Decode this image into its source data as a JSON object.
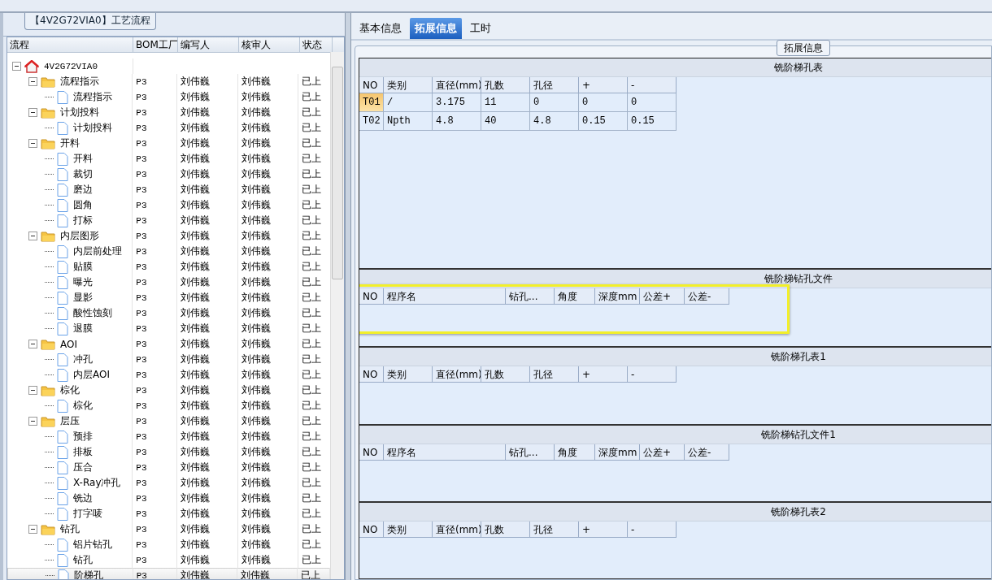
{
  "left_panel": {
    "title": "【4V2G72VIA0】工艺流程",
    "columns": [
      "流程",
      "BOM工厂",
      "编写人",
      "核审人",
      "状态"
    ],
    "tree": [
      {
        "name": "4V2G72VIA0",
        "kind": "root",
        "expanded": true,
        "selected": false,
        "children": [
          {
            "name": "流程指示",
            "kind": "folder",
            "expanded": true,
            "selected": false,
            "cells": [
              "P3",
              "刘伟巍",
              "刘伟巍",
              "已上"
            ],
            "children": [
              {
                "name": "流程指示",
                "kind": "step",
                "selected": false,
                "cells": [
                  "P3",
                  "刘伟巍",
                  "刘伟巍",
                  "已上"
                ]
              }
            ]
          },
          {
            "name": "计划投料",
            "kind": "folder",
            "expanded": true,
            "selected": false,
            "cells": [
              "P3",
              "刘伟巍",
              "刘伟巍",
              "已上"
            ],
            "children": [
              {
                "name": "计划投料",
                "kind": "step",
                "selected": false,
                "cells": [
                  "P3",
                  "刘伟巍",
                  "刘伟巍",
                  "已上"
                ]
              }
            ]
          },
          {
            "name": "开料",
            "kind": "folder",
            "expanded": true,
            "selected": false,
            "cells": [
              "P3",
              "刘伟巍",
              "刘伟巍",
              "已上"
            ],
            "children": [
              {
                "name": "开料",
                "kind": "step",
                "selected": false,
                "cells": [
                  "P3",
                  "刘伟巍",
                  "刘伟巍",
                  "已上"
                ]
              },
              {
                "name": "裁切",
                "kind": "step",
                "selected": false,
                "cells": [
                  "P3",
                  "刘伟巍",
                  "刘伟巍",
                  "已上"
                ]
              },
              {
                "name": "磨边",
                "kind": "step",
                "selected": false,
                "cells": [
                  "P3",
                  "刘伟巍",
                  "刘伟巍",
                  "已上"
                ]
              },
              {
                "name": "圆角",
                "kind": "step",
                "selected": false,
                "cells": [
                  "P3",
                  "刘伟巍",
                  "刘伟巍",
                  "已上"
                ]
              },
              {
                "name": "打标",
                "kind": "step",
                "selected": false,
                "cells": [
                  "P3",
                  "刘伟巍",
                  "刘伟巍",
                  "已上"
                ]
              }
            ]
          },
          {
            "name": "内层图形",
            "kind": "folder",
            "expanded": true,
            "selected": false,
            "cells": [
              "P3",
              "刘伟巍",
              "刘伟巍",
              "已上"
            ],
            "children": [
              {
                "name": "内层前处理",
                "kind": "step",
                "selected": false,
                "cells": [
                  "P3",
                  "刘伟巍",
                  "刘伟巍",
                  "已上"
                ]
              },
              {
                "name": "贴膜",
                "kind": "step",
                "selected": false,
                "cells": [
                  "P3",
                  "刘伟巍",
                  "刘伟巍",
                  "已上"
                ]
              },
              {
                "name": "曝光",
                "kind": "step",
                "selected": false,
                "cells": [
                  "P3",
                  "刘伟巍",
                  "刘伟巍",
                  "已上"
                ]
              },
              {
                "name": "显影",
                "kind": "step",
                "selected": false,
                "cells": [
                  "P3",
                  "刘伟巍",
                  "刘伟巍",
                  "已上"
                ]
              },
              {
                "name": "酸性蚀刻",
                "kind": "step",
                "selected": false,
                "cells": [
                  "P3",
                  "刘伟巍",
                  "刘伟巍",
                  "已上"
                ]
              },
              {
                "name": "退膜",
                "kind": "step",
                "selected": false,
                "cells": [
                  "P3",
                  "刘伟巍",
                  "刘伟巍",
                  "已上"
                ]
              }
            ]
          },
          {
            "name": "AOI",
            "kind": "folder",
            "expanded": true,
            "selected": false,
            "cells": [
              "P3",
              "刘伟巍",
              "刘伟巍",
              "已上"
            ],
            "children": [
              {
                "name": "冲孔",
                "kind": "step",
                "selected": false,
                "cells": [
                  "P3",
                  "刘伟巍",
                  "刘伟巍",
                  "已上"
                ]
              },
              {
                "name": "内层AOI",
                "kind": "step",
                "selected": false,
                "cells": [
                  "P3",
                  "刘伟巍",
                  "刘伟巍",
                  "已上"
                ]
              }
            ]
          },
          {
            "name": "棕化",
            "kind": "folder",
            "expanded": true,
            "selected": false,
            "cells": [
              "P3",
              "刘伟巍",
              "刘伟巍",
              "已上"
            ],
            "children": [
              {
                "name": "棕化",
                "kind": "step",
                "selected": false,
                "cells": [
                  "P3",
                  "刘伟巍",
                  "刘伟巍",
                  "已上"
                ]
              }
            ]
          },
          {
            "name": "层压",
            "kind": "folder",
            "expanded": true,
            "selected": false,
            "cells": [
              "P3",
              "刘伟巍",
              "刘伟巍",
              "已上"
            ],
            "children": [
              {
                "name": "预排",
                "kind": "step",
                "selected": false,
                "cells": [
                  "P3",
                  "刘伟巍",
                  "刘伟巍",
                  "已上"
                ]
              },
              {
                "name": "排板",
                "kind": "step",
                "selected": false,
                "cells": [
                  "P3",
                  "刘伟巍",
                  "刘伟巍",
                  "已上"
                ]
              },
              {
                "name": "压合",
                "kind": "step",
                "selected": false,
                "cells": [
                  "P3",
                  "刘伟巍",
                  "刘伟巍",
                  "已上"
                ]
              },
              {
                "name": "X-Ray冲孔",
                "kind": "step",
                "selected": false,
                "cells": [
                  "P3",
                  "刘伟巍",
                  "刘伟巍",
                  "已上"
                ]
              },
              {
                "name": "铣边",
                "kind": "step",
                "selected": false,
                "cells": [
                  "P3",
                  "刘伟巍",
                  "刘伟巍",
                  "已上"
                ]
              },
              {
                "name": "打字唛",
                "kind": "step",
                "selected": false,
                "cells": [
                  "P3",
                  "刘伟巍",
                  "刘伟巍",
                  "已上"
                ]
              }
            ]
          },
          {
            "name": "钻孔",
            "kind": "folder",
            "expanded": true,
            "selected": false,
            "cells": [
              "P3",
              "刘伟巍",
              "刘伟巍",
              "已上"
            ],
            "children": [
              {
                "name": "铝片钻孔",
                "kind": "step",
                "selected": false,
                "cells": [
                  "P3",
                  "刘伟巍",
                  "刘伟巍",
                  "已上"
                ]
              },
              {
                "name": "钻孔",
                "kind": "step",
                "selected": false,
                "cells": [
                  "P3",
                  "刘伟巍",
                  "刘伟巍",
                  "已上"
                ]
              },
              {
                "name": "阶梯孔",
                "kind": "step",
                "selected": true,
                "cells": [
                  "P3",
                  "刘伟巍",
                  "刘伟巍",
                  "已上"
                ]
              }
            ]
          }
        ]
      }
    ]
  },
  "tabs": [
    {
      "label": "基本信息",
      "selected": false
    },
    {
      "label": "拓展信息",
      "selected": true
    },
    {
      "label": "工时",
      "selected": false
    }
  ],
  "group_title": "拓展信息",
  "sections": [
    {
      "title": "铣阶梯孔表",
      "kind": "holes",
      "highlighted": false,
      "columns": [
        "NO",
        "类别",
        "直径(mm)",
        "孔数",
        "孔径",
        "+",
        "-"
      ],
      "rows": [
        {
          "selected": true,
          "cells": [
            "T01",
            "/",
            "3.175",
            "11",
            "0",
            "0",
            "0"
          ]
        },
        {
          "selected": false,
          "cells": [
            "T02",
            "Npth",
            "4.8",
            "40",
            "4.8",
            "0.15",
            "0.15"
          ]
        }
      ]
    },
    {
      "title": "铣阶梯钻孔文件",
      "kind": "files",
      "highlighted": true,
      "columns": [
        "NO",
        "程序名",
        "钻孔...",
        "角度",
        "深度mm",
        "公差+",
        "公差-"
      ]
    },
    {
      "title": "铣阶梯孔表1",
      "kind": "holes",
      "highlighted": false,
      "columns": [
        "NO",
        "类别",
        "直径(mm)",
        "孔数",
        "孔径",
        "+",
        "-"
      ]
    },
    {
      "title": "铣阶梯钻孔文件1",
      "kind": "files",
      "highlighted": false,
      "columns": [
        "NO",
        "程序名",
        "钻孔...",
        "角度",
        "深度mm",
        "公差+",
        "公差-"
      ]
    },
    {
      "title": "铣阶梯孔表2",
      "kind": "holes",
      "highlighted": false,
      "columns": [
        "NO",
        "类别",
        "直径(mm)",
        "孔数",
        "孔径",
        "+",
        "-"
      ]
    }
  ]
}
